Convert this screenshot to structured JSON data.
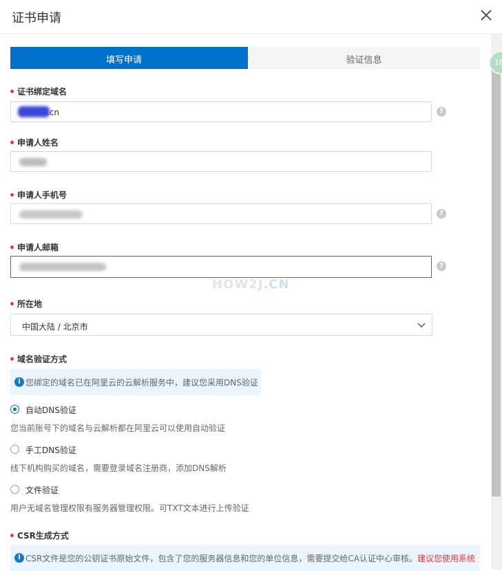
{
  "dialog": {
    "title": "证书申请",
    "close_icon": "close-icon"
  },
  "steps": [
    {
      "label": "填写申请",
      "active": true
    },
    {
      "label": "验证信息",
      "active": false
    }
  ],
  "fields": {
    "domain": {
      "label": "证书绑定域名",
      "value_suffix": ".cn"
    },
    "name": {
      "label": "申请人姓名"
    },
    "phone": {
      "label": "申请人手机号"
    },
    "email": {
      "label": "申请人邮箱"
    },
    "location": {
      "label": "所在地",
      "value": "中国大陆 / 北京市"
    }
  },
  "help_icon": "?",
  "verify": {
    "label": "域名验证方式",
    "notice": "您绑定的域名已在阿里云的云解析服务中，建议您采用DNS验证",
    "options": [
      {
        "label": "自动DNS验证",
        "desc": "您当前账号下的域名与云解析都在阿里云可以使用自动验证",
        "checked": true
      },
      {
        "label": "手工DNS验证",
        "desc": "线下机构购买的域名，需要登录域名注册商，添加DNS解析",
        "checked": false
      },
      {
        "label": "文件验证",
        "desc": "用户无域名管理权限有服务器管理权限。可TXT文本进行上传验证",
        "checked": false
      }
    ]
  },
  "csr": {
    "label": "CSR生成方式",
    "notice": "CSR文件是您的公钥证书原始文件，包含了您的服务器信息和您的单位信息，需要提交给CA认证中心审核。",
    "notice_link": "建议您使用系统"
  },
  "watermark": {
    "main": "HOW2J",
    "suffix": ".CN"
  },
  "side_badge": "18",
  "colors": {
    "primary": "#0070cc",
    "required": "#e4393c",
    "notice_bg": "#eaf4fc"
  }
}
